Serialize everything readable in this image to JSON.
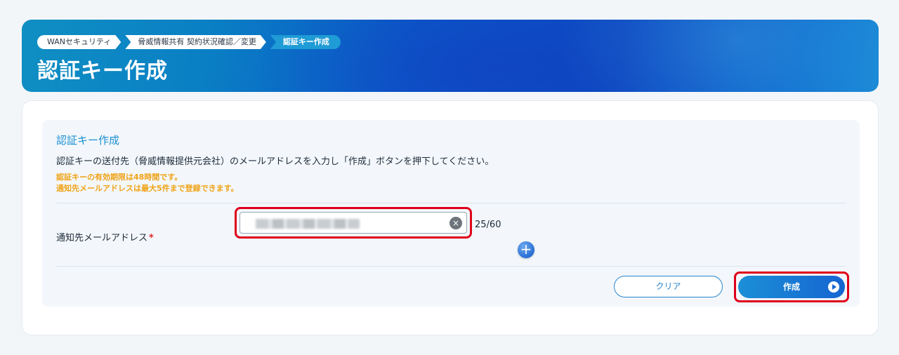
{
  "breadcrumb": {
    "items": [
      "WANセキュリティ",
      "脅威情報共有 契約状況確認／変更",
      "認証キー作成"
    ]
  },
  "header": {
    "title": "認証キー作成"
  },
  "section": {
    "title": "認証キー作成",
    "description": "認証キーの送付先（脅威情報提供元会社）のメールアドレスを入力し「作成」ボタンを押下してください。",
    "notes": [
      "認証キーの有効期限は48時間です。",
      "通知先メールアドレスは最大5件まで登録できます。"
    ]
  },
  "form": {
    "email_label": "通知先メールアドレス",
    "required_mark": "*",
    "clear_glyph": "×",
    "counter": "25/60",
    "add_glyph": "+"
  },
  "actions": {
    "clear_label": "クリア",
    "create_label": "作成"
  },
  "colors": {
    "accent": "#1b8fd0",
    "warning": "#f0a318",
    "required": "#e2282b",
    "highlight": "#e0001b"
  }
}
